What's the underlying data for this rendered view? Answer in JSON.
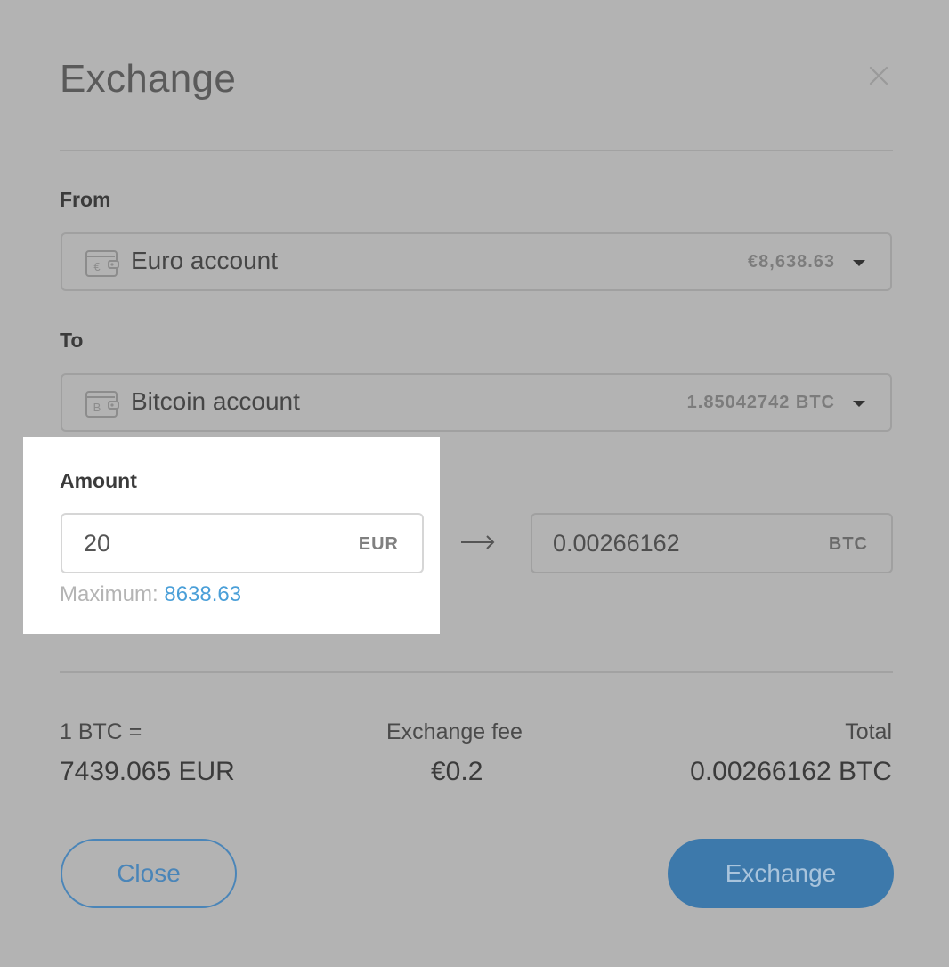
{
  "dialog": {
    "title": "Exchange"
  },
  "from": {
    "label": "From",
    "account_name": "Euro account",
    "balance": "€8,638.63",
    "wallet_symbol": "€"
  },
  "to": {
    "label": "To",
    "account_name": "Bitcoin account",
    "balance": "1.85042742 BTC",
    "wallet_symbol": "B"
  },
  "amount": {
    "label": "Amount",
    "value": "20",
    "unit": "EUR",
    "maximum_label": "Maximum:",
    "maximum_value": "8638.63"
  },
  "result": {
    "value": "0.00266162",
    "unit": "BTC"
  },
  "summary": {
    "rate_label": "1 BTC =",
    "rate_value": "7439.065 EUR",
    "fee_label": "Exchange fee",
    "fee_value": "€0.2",
    "total_label": "Total",
    "total_value": "0.00266162 BTC"
  },
  "buttons": {
    "close": "Close",
    "exchange": "Exchange"
  },
  "colors": {
    "backdrop": "#b3b3b3",
    "highlight": "#ffffff",
    "link": "#4a9fd8",
    "primary_button": "#3d79ab",
    "outline_button": "#4a85b8"
  }
}
